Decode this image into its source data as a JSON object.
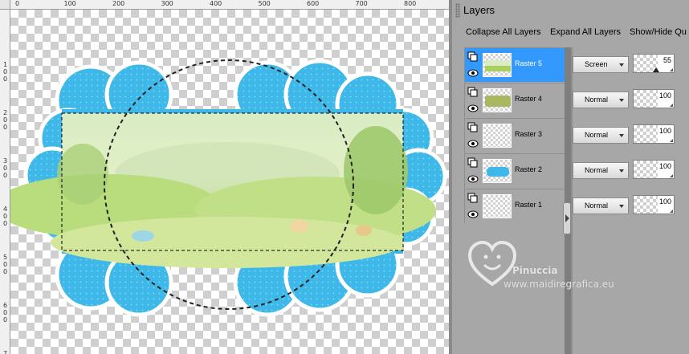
{
  "ruler": {
    "top_labels": [
      "0",
      "100",
      "200",
      "300",
      "400",
      "500",
      "600",
      "700",
      "800"
    ],
    "left_labels": [
      "1\n0\n0",
      "2\n0\n0",
      "3\n0\n0",
      "4\n0\n0",
      "5\n0\n0",
      "6\n0\n0",
      "7\n0\n0"
    ]
  },
  "layers_panel": {
    "title": "Layers",
    "toolbar": {
      "collapse": "Collapse All Layers",
      "expand": "Expand All Layers",
      "show_hide": "Show/Hide Qu"
    },
    "layers": [
      {
        "name": "Raster 5",
        "blend": "Screen",
        "opacity": "55",
        "opacity_level": 0.55,
        "selected": true,
        "thumb": "landscape"
      },
      {
        "name": "Raster 4",
        "blend": "Normal",
        "opacity": "100",
        "opacity_level": 1.0,
        "selected": false,
        "thumb": "green-fill"
      },
      {
        "name": "Raster 3",
        "blend": "Normal",
        "opacity": "100",
        "opacity_level": 1.0,
        "selected": false,
        "thumb": "empty"
      },
      {
        "name": "Raster 2",
        "blend": "Normal",
        "opacity": "100",
        "opacity_level": 1.0,
        "selected": false,
        "thumb": "blue-frame"
      },
      {
        "name": "Raster 1",
        "blend": "Normal",
        "opacity": "100",
        "opacity_level": 1.0,
        "selected": false,
        "thumb": "empty"
      }
    ]
  },
  "watermark": {
    "name": "Pinuccia",
    "url": "www.maidiregrafica.eu"
  },
  "colors": {
    "selection_blue": "#3399ff",
    "frame_blue": "#3db8e8",
    "panel_gray": "#a7a7a7",
    "green_fill": "#a9b860"
  },
  "icons": {
    "layer_stack": "layer-stack-icon",
    "visibility": "eye-icon",
    "watermark": "heart-smile-logo"
  }
}
